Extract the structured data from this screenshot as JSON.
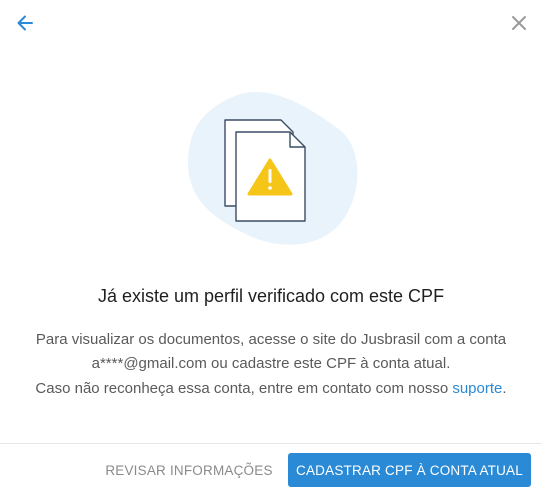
{
  "header": {
    "back_icon": "arrow-left-icon",
    "close_icon": "close-icon"
  },
  "illustration": {
    "icon": "documents-warning-icon"
  },
  "content": {
    "title": "Já existe um perfil verificado com este CPF",
    "paragraph1": "Para visualizar os documentos, acesse o site do Jusbrasil com a conta a****@gmail.com ou cadastre este CPF à conta atual.",
    "paragraph2_text": "Caso não reconheça essa conta, entre em contato com nosso ",
    "paragraph2_link": "suporte",
    "paragraph2_end": "."
  },
  "footer": {
    "secondary_label": "REVISAR INFORMAÇÕES",
    "primary_label": "CADASTRAR CPF À CONTA ATUAL"
  },
  "colors": {
    "accent": "#2b8ad6",
    "blob": "#e9f3fb",
    "warning": "#f5c518",
    "icon_stroke": "#3a4d63"
  }
}
